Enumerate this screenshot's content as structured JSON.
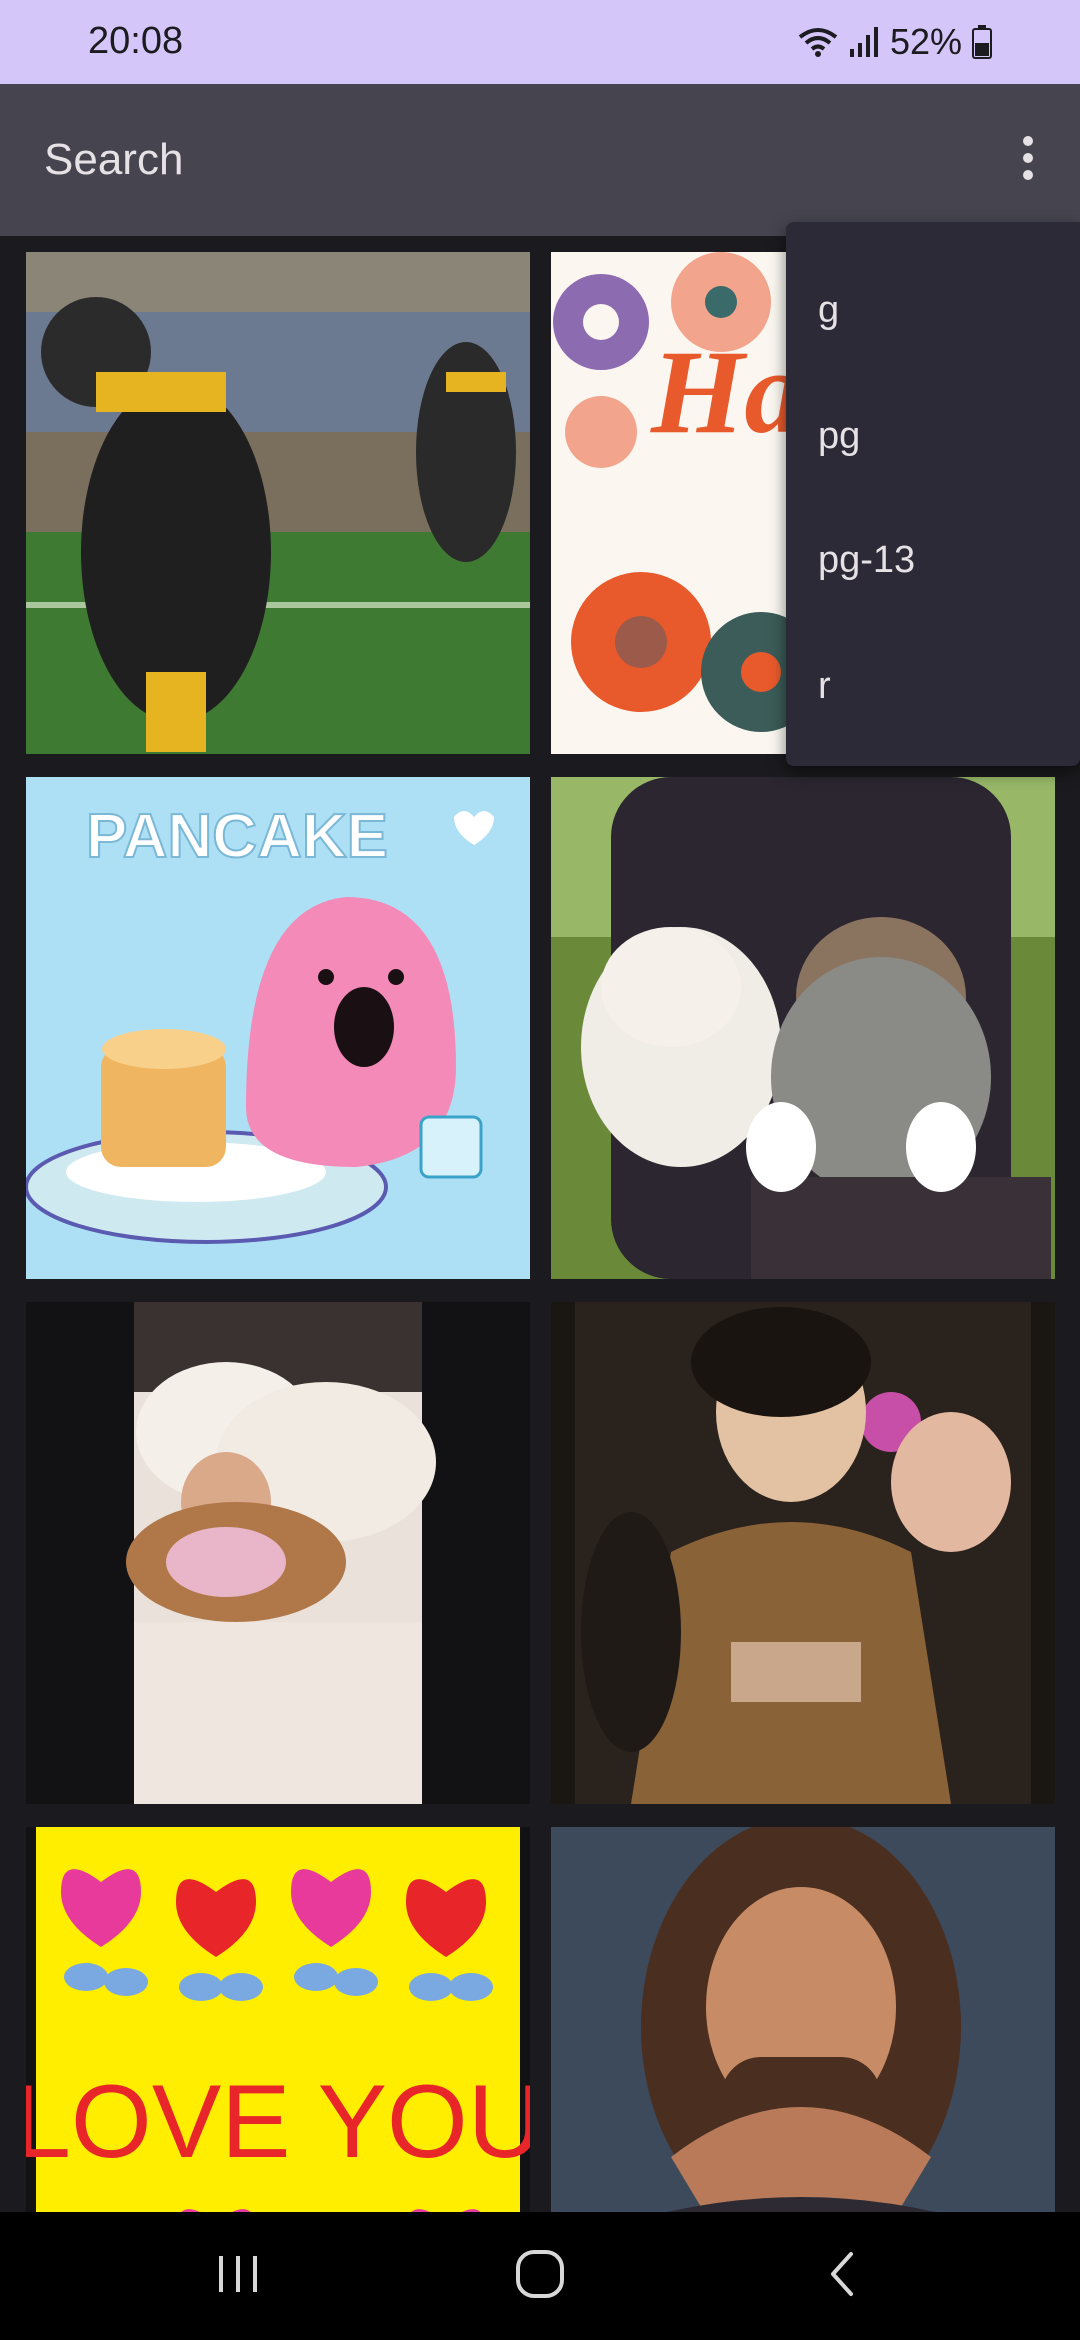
{
  "status_bar": {
    "time": "20:08",
    "battery": "52%"
  },
  "search": {
    "placeholder": "Search"
  },
  "menu": {
    "items": [
      "g",
      "pg",
      "pg-13",
      "r"
    ]
  },
  "gifs": [
    {
      "subject": "football player celebrating"
    },
    {
      "subject": "happy birthday floral card",
      "text": "Happy Birthday"
    },
    {
      "subject": "pink dinosaur with pancakes",
      "text": "PANCAKE"
    },
    {
      "subject": "two cats in a stroller"
    },
    {
      "subject": "child hugging a sleeping dog"
    },
    {
      "subject": "man dancing in leopard shirt"
    },
    {
      "subject": "hearts card",
      "text": "LOVE YOU"
    },
    {
      "subject": "man making heart with hands"
    }
  ],
  "nav": {
    "icons": [
      "recent-apps-icon",
      "home-icon",
      "back-icon"
    ]
  }
}
